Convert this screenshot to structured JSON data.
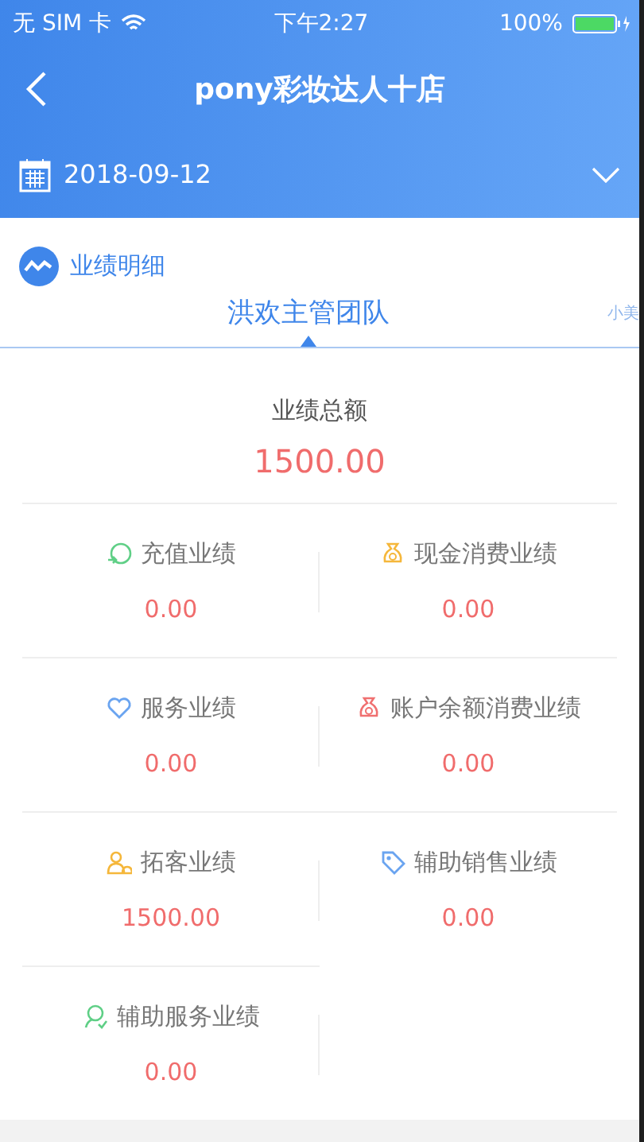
{
  "status_bar": {
    "carrier": "无 SIM 卡",
    "time": "下午2:27",
    "battery": "100%"
  },
  "nav": {
    "title": "pony彩妆达人十店"
  },
  "date_picker": {
    "value": "2018-09-12"
  },
  "section": {
    "title": "业绩明细"
  },
  "tabs": [
    {
      "label": "洪欢主管团队",
      "selected": true
    },
    {
      "label": "小美",
      "selected": false
    }
  ],
  "total": {
    "label": "业绩总额",
    "value": "1500.00"
  },
  "metrics": [
    {
      "kind": "recharge",
      "label": "充值业绩",
      "value": "0.00"
    },
    {
      "kind": "cash",
      "label": "现金消费业绩",
      "value": "0.00"
    },
    {
      "kind": "service",
      "label": "服务业绩",
      "value": "0.00"
    },
    {
      "kind": "account",
      "label": "账户余额消费业绩",
      "value": "0.00"
    },
    {
      "kind": "customer",
      "label": "拓客业绩",
      "value": "1500.00"
    },
    {
      "kind": "assist-sale",
      "label": "辅助销售业绩",
      "value": "0.00"
    },
    {
      "kind": "assist-service",
      "label": "辅助服务业绩",
      "value": "0.00"
    }
  ]
}
